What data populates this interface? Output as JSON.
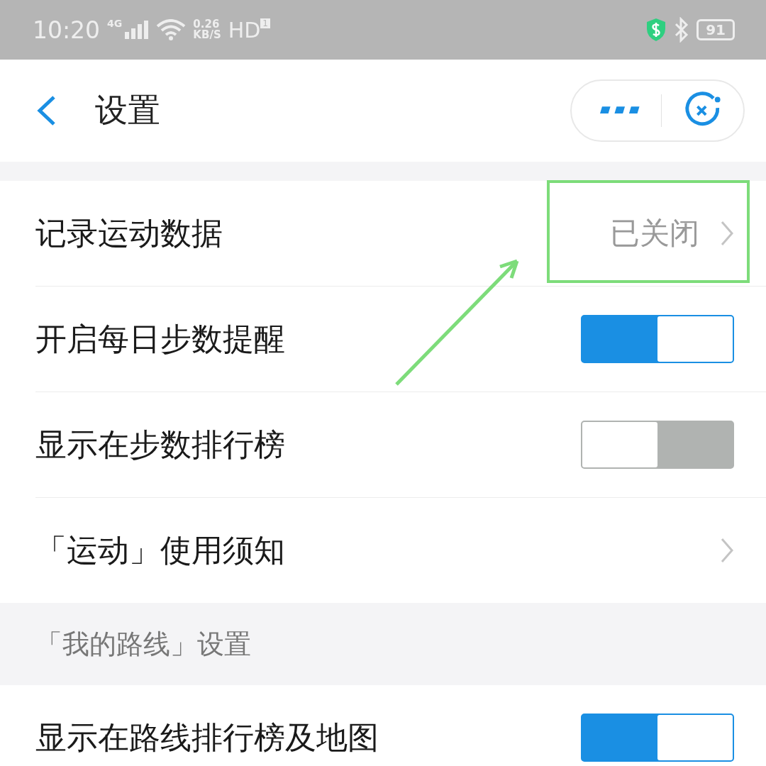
{
  "status_bar": {
    "time": "10:20",
    "network": "4G",
    "speed": "0.26",
    "speed_unit": "KB/S",
    "hd": "HD",
    "sim": "1",
    "battery": "91"
  },
  "header": {
    "title": "设置"
  },
  "sections": [
    {
      "rows": [
        {
          "kind": "link",
          "label": "记录运动数据",
          "value": "已关闭"
        },
        {
          "kind": "toggle",
          "label": "开启每日步数提醒",
          "on": true
        },
        {
          "kind": "toggle",
          "label": "显示在步数排行榜",
          "on": false
        },
        {
          "kind": "link",
          "label": "「运动」使用须知"
        }
      ]
    },
    {
      "title": "「我的路线」设置",
      "rows": [
        {
          "kind": "toggle",
          "label": "显示在路线排行榜及地图",
          "on": true
        }
      ]
    }
  ]
}
